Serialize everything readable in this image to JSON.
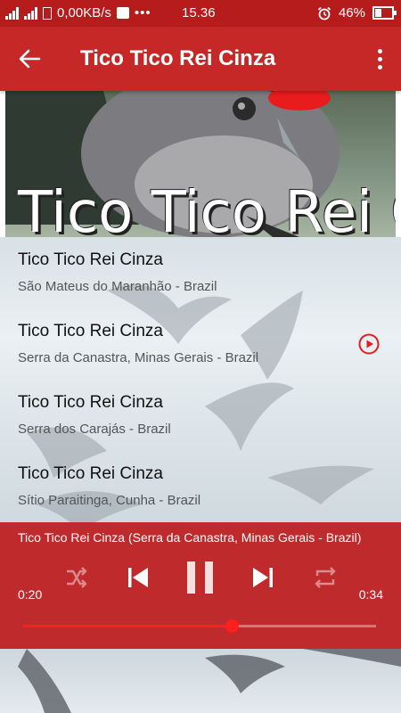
{
  "status_bar": {
    "speed": "0,00KB/s",
    "time": "15.36",
    "battery_percent": "46%",
    "battery_level": 0.46,
    "icons": [
      "signal-icon",
      "signal-icon",
      "battery-saver-icon",
      "bbm-icon",
      "more-dots-icon",
      "alarm-icon",
      "battery-icon"
    ]
  },
  "app_bar": {
    "title": "Tico Tico Rei Cinza",
    "icons": [
      "back-arrow-icon",
      "overflow-menu-icon"
    ]
  },
  "hero": {
    "caption": "Tico Tico Rei Cinza"
  },
  "tracks": [
    {
      "title": "Tico Tico Rei Cinza",
      "location": "São Mateus do Maranhão - Brazil",
      "playing": false
    },
    {
      "title": "Tico Tico Rei Cinza",
      "location": "Serra da Canastra, Minas Gerais - Brazil",
      "playing": true
    },
    {
      "title": "Tico Tico Rei Cinza",
      "location": "Serra dos Carajás - Brazil",
      "playing": false
    },
    {
      "title": "Tico Tico Rei Cinza",
      "location": "Sítio Paraitinga, Cunha - Brazil",
      "playing": false
    }
  ],
  "player": {
    "now_playing": "Tico Tico Rei Cinza (Serra da Canastra, Minas Gerais - Brazil)",
    "current_time": "0:20",
    "duration": "0:34",
    "progress": 0.59,
    "icons": [
      "shuffle-icon",
      "previous-icon",
      "pause-icon",
      "next-icon",
      "repeat-icon"
    ]
  },
  "colors": {
    "primary": "#c62828",
    "status_bar": "#b71c1c",
    "accent": "#ff1f1f"
  }
}
